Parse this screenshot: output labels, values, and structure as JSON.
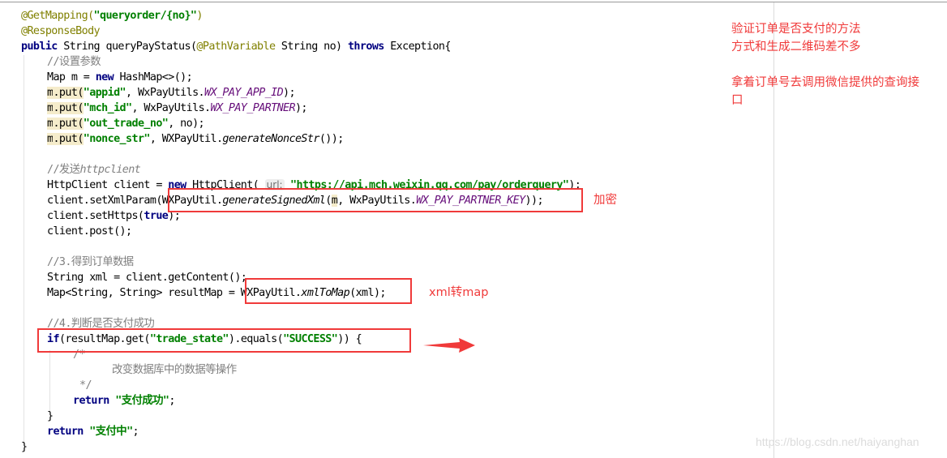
{
  "code": {
    "l1": {
      "ann": "@GetMapping(",
      "str": "\"queryorder/{no}\"",
      "end": ")"
    },
    "l2": {
      "ann": "@ResponseBody"
    },
    "l3": {
      "kw1": "public",
      "t1": " String queryPayStatus(",
      "ann": "@PathVariable",
      "t2": " String no) ",
      "kw2": "throws",
      "t3": " Exception{"
    },
    "l4": {
      "cmt": "//设置参数"
    },
    "l5": {
      "t1": "Map m = ",
      "kw": "new",
      "t2": " HashMap<>();"
    },
    "puts": [
      {
        "m": "m",
        "t1": ".put(",
        "str": "\"appid\"",
        "t2": ", WxPayUtils.",
        "const": "WX_PAY_APP_ID",
        "t3": ");"
      },
      {
        "m": "m",
        "t1": ".put(",
        "str": "\"mch_id\"",
        "t2": ", WxPayUtils.",
        "const": "WX_PAY_PARTNER",
        "t3": ");"
      },
      {
        "m": "m",
        "t1": ".put(",
        "str": "\"out_trade_no\"",
        "t2": ", no);",
        "const": "",
        "t3": ""
      },
      {
        "m": "m",
        "t1": ".put(",
        "str": "\"nonce_str\"",
        "t2": ", WXPayUtil.",
        "static": "generateNonceStr",
        "t3": "());"
      }
    ],
    "l11": {
      "cmt": "//发送",
      "cmt_i": "httpclient"
    },
    "l12": {
      "t1": "HttpClient client = ",
      "kw": "new",
      "t2": " HttpClient( ",
      "hint": "url:",
      "str": " \"https://api.mch.weixin.qq.com/pay/orderquery\"",
      "t3": ");"
    },
    "l13": {
      "t1": "client.setXmlParam(WXPayUtil.",
      "static": "generateSignedXml",
      "t2": "(",
      "m": "m",
      "t3": ", WxPayUtils.",
      "const": "WX_PAY_PARTNER_KEY",
      "t4": "));"
    },
    "l14": {
      "t1": "client.setHttps(",
      "kw": "true",
      "t2": ");"
    },
    "l15": {
      "t1": "client.post();"
    },
    "l17": {
      "cmt": "//3.得到订单数据"
    },
    "l18": {
      "t1": "String xml = client.getContent();"
    },
    "l19": {
      "t1": "Map<String, String> resultMap = WXPayUtil.",
      "static": "xmlToMap",
      "t2": "(xml);"
    },
    "l21": {
      "cmt": "//4.判断是否支付成功"
    },
    "l22": {
      "kw": "if",
      "t1": "(resultMap.get(",
      "str1": "\"trade_state\"",
      "t2": ").equals(",
      "str2": "\"SUCCESS\"",
      "t3": ")) {"
    },
    "l23": {
      "cmt": "/*"
    },
    "l24": {
      "cmt": "改变数据库中的数据等操作"
    },
    "l25": {
      "cmt": "*/"
    },
    "l26": {
      "kw": "return",
      "str": " \"支付成功\"",
      "t1": ";"
    },
    "l27": {
      "t1": "}"
    },
    "l28": {
      "kw": "return",
      "str": " \"支付中\"",
      "t1": ";"
    },
    "l29": {
      "t1": "}"
    }
  },
  "annotations": {
    "encrypt": "加密",
    "xml_to_map": "xml转map",
    "side_note": "验证订单是否支付的方法\n方式和生成二维码差不多\n\n拿着订单号去调用微信提供的查询接\n口"
  },
  "colors": {
    "accent_red": "#f03a3a",
    "keyword": "#000080",
    "string": "#008000",
    "annotation": "#808000",
    "constant": "#660e7a"
  },
  "watermark": "https://blog.csdn.net/haiyanghan"
}
